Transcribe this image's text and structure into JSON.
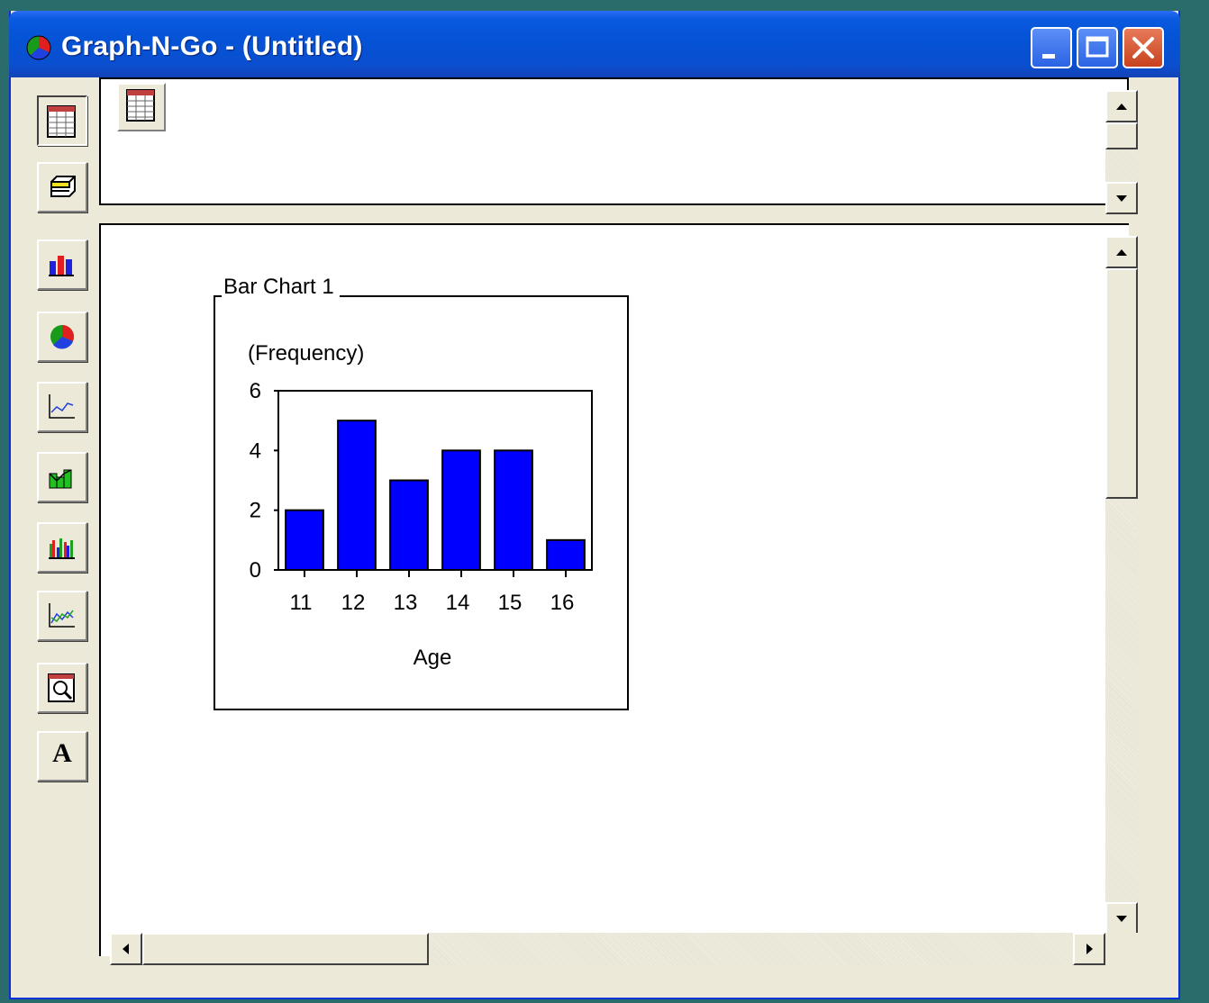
{
  "window": {
    "title": "Graph-N-Go - (Untitled)"
  },
  "sidebar": {
    "tools": [
      {
        "name": "table-tool",
        "icon": "spreadsheet-icon"
      },
      {
        "name": "database-tool",
        "icon": "database-icon"
      },
      {
        "name": "bar-chart-tool",
        "icon": "bar-chart-icon"
      },
      {
        "name": "pie-chart-tool",
        "icon": "pie-chart-icon"
      },
      {
        "name": "line-chart-tool",
        "icon": "line-chart-icon"
      },
      {
        "name": "histogram-tool",
        "icon": "histogram-icon"
      },
      {
        "name": "multi-bar-tool",
        "icon": "multi-bar-icon"
      },
      {
        "name": "multi-line-tool",
        "icon": "multi-line-icon"
      },
      {
        "name": "report-tool",
        "icon": "report-search-icon"
      },
      {
        "name": "text-tool",
        "icon": "text-a-icon",
        "label": "A"
      }
    ]
  },
  "chart_panel": {
    "caption": "Bar Chart 1"
  },
  "chart_data": {
    "type": "bar",
    "title": "",
    "ylabel": "(Frequency)",
    "xlabel": "Age",
    "categories": [
      "11",
      "12",
      "13",
      "14",
      "15",
      "16"
    ],
    "values": [
      2,
      5,
      3,
      4,
      4,
      1
    ],
    "ylim": [
      0,
      6
    ],
    "yticks": [
      0,
      2,
      4,
      6
    ],
    "bar_color": "#0000ff",
    "grid": false
  },
  "colors": {
    "titlebar": "#0553d6",
    "window_bg": "#ece9d8",
    "bar": "#0000ff"
  }
}
